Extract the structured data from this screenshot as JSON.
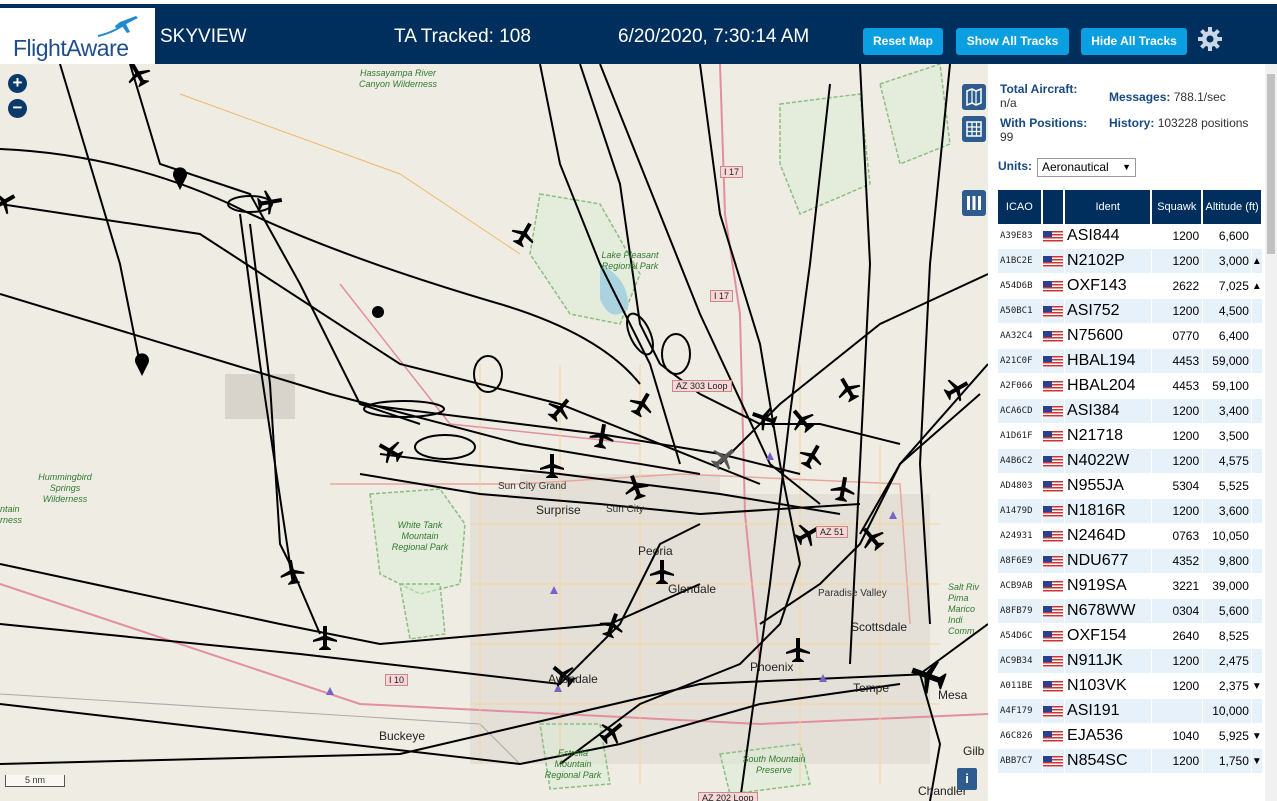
{
  "header": {
    "logo_text": "FlightAware",
    "app_title": "SKYVIEW",
    "tracked": "TA Tracked: 108",
    "clock": "6/20/2020, 7:30:14 AM",
    "buttons": {
      "reset": "Reset Map",
      "show_all": "Show All Tracks",
      "hide_all": "Hide All Tracks"
    }
  },
  "map": {
    "zoom_in": "+",
    "zoom_out": "−",
    "scale": "5 nm",
    "info": "i",
    "labels": {
      "hassayampa": "Hassayampa River Canyon Wilderness",
      "lake_pleasant": "Lake Pleasant Regional Park",
      "hummingbird": "Hummingbird Springs Wilderness",
      "white_tank": "White Tank Mountain Regional Park",
      "mountains": "ntain rness",
      "estrella": "Estrella Mountain Regional Park",
      "south_mountain": "South Mountain Preserve",
      "salt_river": "Salt Riv Pima Marico Indi Comm",
      "sun_city_grand": "Sun City Grand",
      "surprise": "Surprise",
      "sun_city": "Sun City",
      "peoria": "Peoria",
      "glendale": "Glendale",
      "paradise_valley": "Paradise Valley",
      "scottsdale": "Scottsdale",
      "phoenix": "Phoenix",
      "tempe": "Tempe",
      "mesa": "Mesa",
      "avondale": "Avondale",
      "buckeye": "Buckeye",
      "gilbert": "Gilb",
      "chandler": "Chandler",
      "i17_a": "I 17",
      "i17_b": "I 17",
      "i10": "I 10",
      "loop303": "AZ 303 Loop",
      "loop51": "AZ 51",
      "loop202": "AZ 202 Loop"
    }
  },
  "sidebar": {
    "total_label": "Total Aircraft:",
    "total_value": "n/a",
    "messages_label": "Messages:",
    "messages_value": "788.1/sec",
    "positions_label": "With Positions:",
    "positions_value": "99",
    "history_label": "History:",
    "history_value": "103228 positions",
    "units_label": "Units:",
    "units_value": "Aeronautical"
  },
  "table": {
    "headers": {
      "icao": "ICAO",
      "flag": "",
      "ident": "Ident",
      "squawk": "Squawk",
      "altitude": "Altitude (ft)"
    },
    "rows": [
      {
        "icao": "A39E83",
        "ident": "ASI844",
        "squawk": "1200",
        "alt": "6,600",
        "trend": ""
      },
      {
        "icao": "A1BC2E",
        "ident": "N2102P",
        "squawk": "1200",
        "alt": "3,000",
        "trend": "▲"
      },
      {
        "icao": "A54D6B",
        "ident": "OXF143",
        "squawk": "2622",
        "alt": "7,025",
        "trend": "▲"
      },
      {
        "icao": "A50BC1",
        "ident": "ASI752",
        "squawk": "1200",
        "alt": "4,500",
        "trend": ""
      },
      {
        "icao": "AA32C4",
        "ident": "N75600",
        "squawk": "0770",
        "alt": "6,400",
        "trend": ""
      },
      {
        "icao": "A21C0F",
        "ident": "HBAL194",
        "squawk": "4453",
        "alt": "59,000",
        "trend": ""
      },
      {
        "icao": "A2F066",
        "ident": "HBAL204",
        "squawk": "4453",
        "alt": "59,100",
        "trend": ""
      },
      {
        "icao": "ACA6CD",
        "ident": "ASI384",
        "squawk": "1200",
        "alt": "3,400",
        "trend": ""
      },
      {
        "icao": "A1D61F",
        "ident": "N21718",
        "squawk": "1200",
        "alt": "3,500",
        "trend": ""
      },
      {
        "icao": "A4B6C2",
        "ident": "N4022W",
        "squawk": "1200",
        "alt": "4,575",
        "trend": ""
      },
      {
        "icao": "AD4803",
        "ident": "N955JA",
        "squawk": "5304",
        "alt": "5,525",
        "trend": ""
      },
      {
        "icao": "A1479D",
        "ident": "N1816R",
        "squawk": "1200",
        "alt": "3,600",
        "trend": ""
      },
      {
        "icao": "A24931",
        "ident": "N2464D",
        "squawk": "0763",
        "alt": "10,050",
        "trend": ""
      },
      {
        "icao": "A8F6E9",
        "ident": "NDU677",
        "squawk": "4352",
        "alt": "9,800",
        "trend": ""
      },
      {
        "icao": "ACB9AB",
        "ident": "N919SA",
        "squawk": "3221",
        "alt": "39,000",
        "trend": ""
      },
      {
        "icao": "A8FB79",
        "ident": "N678WW",
        "squawk": "0304",
        "alt": "5,600",
        "trend": ""
      },
      {
        "icao": "A54D6C",
        "ident": "OXF154",
        "squawk": "2640",
        "alt": "8,525",
        "trend": ""
      },
      {
        "icao": "AC9B34",
        "ident": "N911JK",
        "squawk": "1200",
        "alt": "2,475",
        "trend": ""
      },
      {
        "icao": "A011BE",
        "ident": "N103VK",
        "squawk": "1200",
        "alt": "2,375",
        "trend": "▼"
      },
      {
        "icao": "A4F179",
        "ident": "ASI191",
        "squawk": "",
        "alt": "10,000",
        "trend": ""
      },
      {
        "icao": "A6C826",
        "ident": "EJA536",
        "squawk": "1040",
        "alt": "5,925",
        "trend": "▼"
      },
      {
        "icao": "ABB7C7",
        "ident": "N854SC",
        "squawk": "1200",
        "alt": "1,750",
        "trend": "▼"
      }
    ]
  },
  "colors": {
    "header_bg": "#002f5d",
    "button_bg": "#0a9fe0",
    "map_bg": "#efece4",
    "row_alt": "#e6f1fa",
    "track": "#000000"
  }
}
